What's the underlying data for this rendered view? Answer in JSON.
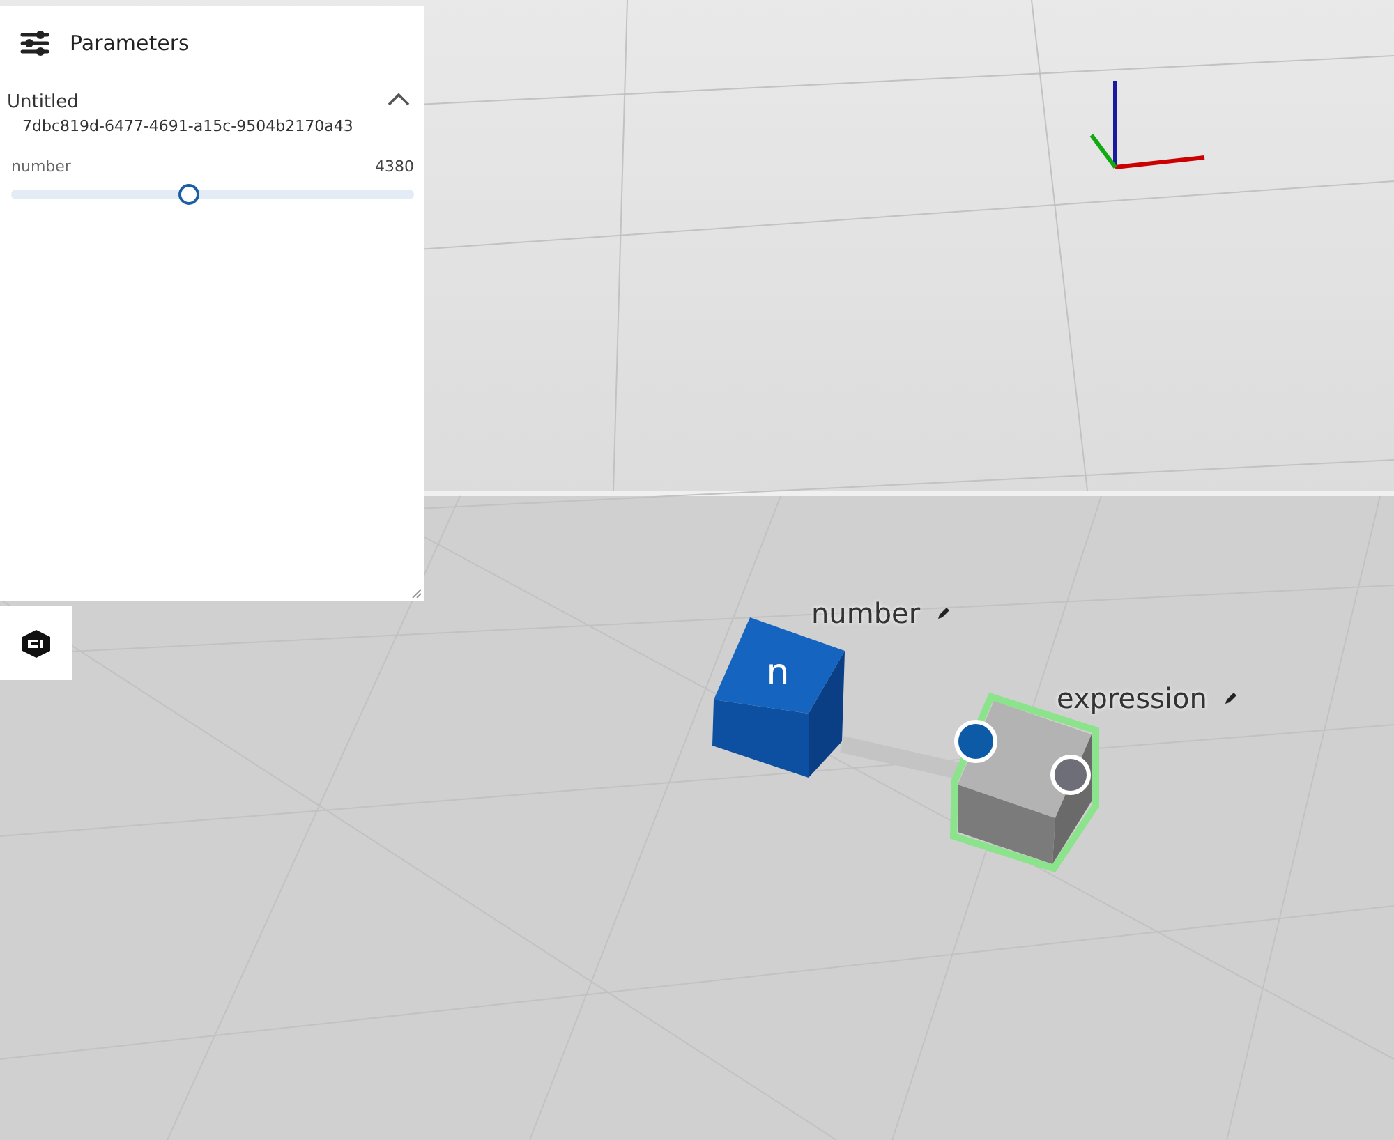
{
  "panel": {
    "title": "Parameters",
    "section": {
      "name": "Untitled",
      "id": "7dbc819d-6477-4691-a15c-9504b2170a43",
      "expanded": true,
      "parameters": [
        {
          "label": "number",
          "value": "4380",
          "level": 0.44
        }
      ]
    }
  },
  "graph": {
    "nodes": [
      {
        "kind": "number",
        "label": "number",
        "glyph": "n",
        "selected": false
      },
      {
        "kind": "expression",
        "label": "expression",
        "selected": true
      }
    ]
  }
}
